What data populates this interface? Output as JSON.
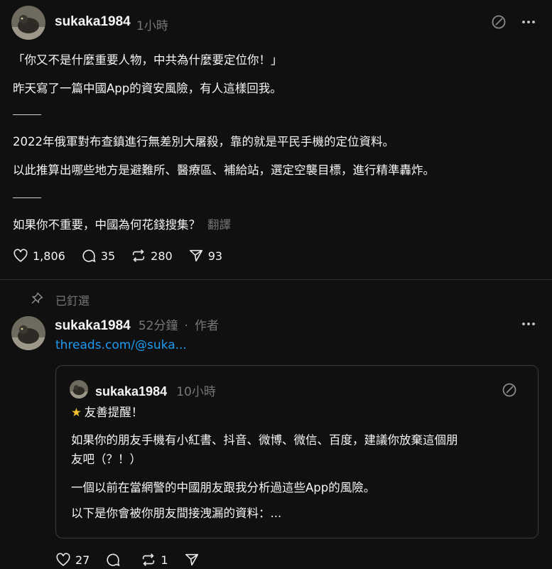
{
  "post": {
    "username": "sukaka1984",
    "time": "1小時",
    "lines": [
      "「你又不是什麼重要人物，中共為什麼要定位你！」",
      "昨天寫了一篇中國App的資安風險，有人這樣回我。",
      "2022年俄軍對布查鎮進行無差別大屠殺，靠的就是平民手機的定位資料。",
      "以此推算出哪些地方是避難所、醫療區、補給站，選定空襲目標，進行精準轟炸。",
      "如果你不重要，中國為何花錢搜集？"
    ],
    "translate": "翻譯",
    "likes": "1,806",
    "replies": "35",
    "reposts": "280",
    "shares": "93"
  },
  "pinned_label": "已釘選",
  "reply": {
    "username": "sukaka1984",
    "time": "52分鐘",
    "separator": "·",
    "author_tag": "作者",
    "link": "threads.com/@suka...",
    "likes": "27",
    "reposts": "1"
  },
  "quoted": {
    "username": "sukaka1984",
    "time": "10小時",
    "star": "★",
    "line1": "友善提醒！",
    "line2": "如果你的朋友手機有小紅書、抖音、微博、微信、百度，建議你放棄這個朋",
    "line3": "友吧（？！）",
    "line4": "一個以前在當網警的中國朋友跟我分析過這些App的風險。",
    "line5": "以下是你會被你朋友間接洩漏的資料：..."
  }
}
